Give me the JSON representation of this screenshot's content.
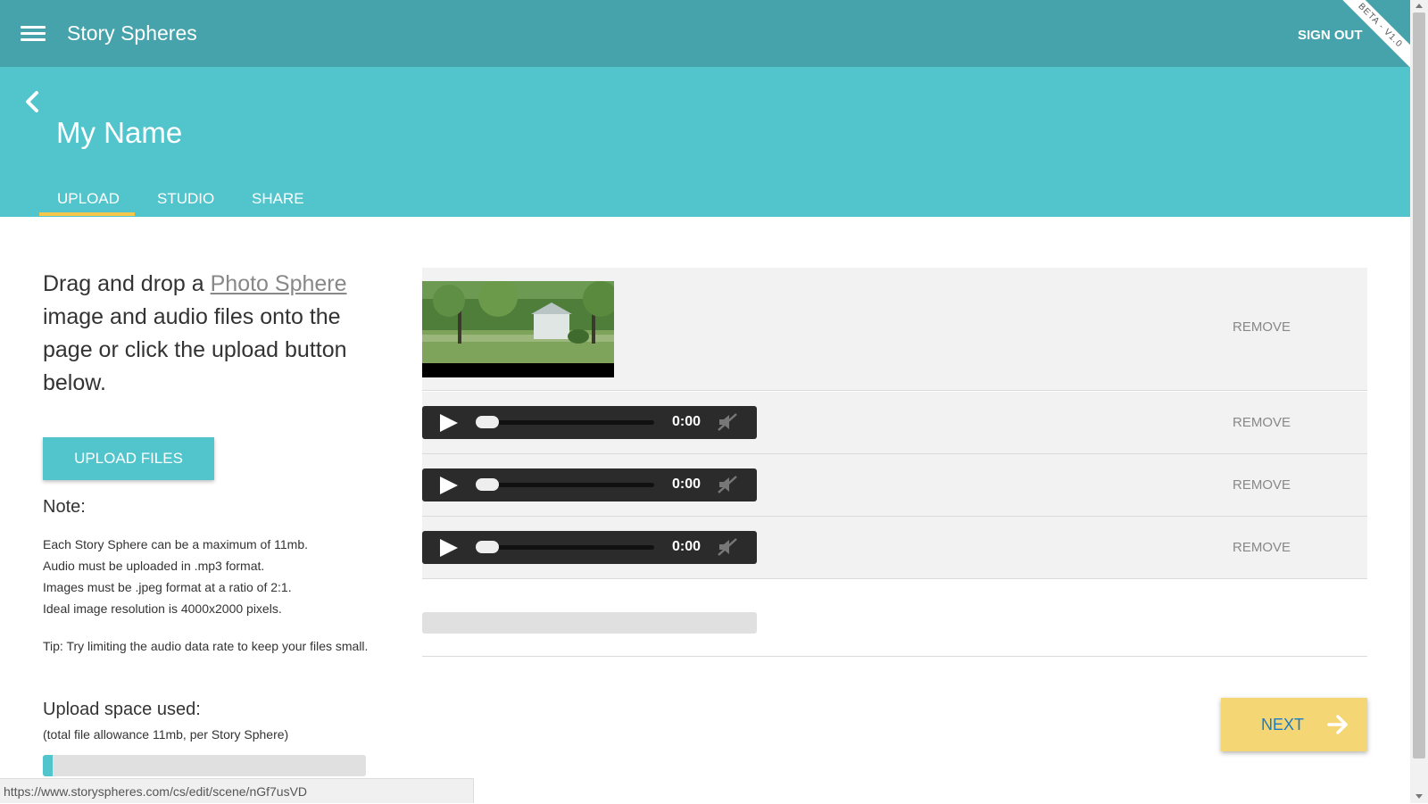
{
  "app": {
    "title": "Story Spheres",
    "sign_out": "SIGN OUT",
    "beta": "BETA - V1.0"
  },
  "header": {
    "page_title": "My Name"
  },
  "tabs": [
    {
      "label": "UPLOAD",
      "active": true
    },
    {
      "label": "STUDIO",
      "active": false
    },
    {
      "label": "SHARE",
      "active": false
    }
  ],
  "intro": {
    "prefix": "Drag and drop a ",
    "link": "Photo Sphere",
    "suffix": " image and audio files onto the page or click the upload button below."
  },
  "upload_button": "UPLOAD FILES",
  "note": {
    "heading": "Note:",
    "lines": [
      "Each Story Sphere can be a maximum of 11mb.",
      "Audio must be uploaded in .mp3 format.",
      "Images must be .jpeg format at a ratio of 2:1.",
      "Ideal image resolution is 4000x2000 pixels."
    ],
    "tip": "Tip: Try limiting the audio data rate to keep your files small."
  },
  "upload_space": {
    "heading": "Upload space used:",
    "subtext": "(total file allowance 11mb, per Story Sphere)",
    "used_fraction": 0.03
  },
  "files": {
    "remove_label": "REMOVE",
    "audio": [
      {
        "time": "0:00"
      },
      {
        "time": "0:00"
      },
      {
        "time": "0:00"
      }
    ]
  },
  "next_button": "NEXT",
  "status_url": "https://www.storyspheres.com/cs/edit/scene/nGf7usVD",
  "colors": {
    "topbar": "#46a3ab",
    "header": "#52c4cc",
    "accent": "#f5c84b",
    "next": "#f5d675",
    "next_text": "#1e7bc0"
  }
}
